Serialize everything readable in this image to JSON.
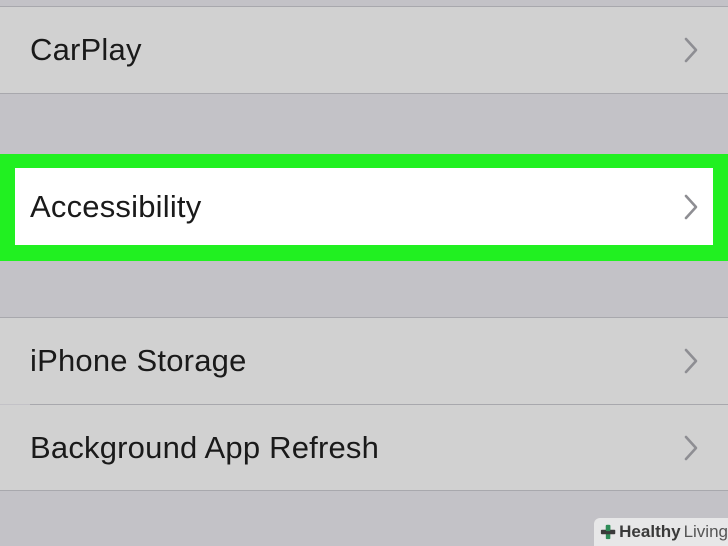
{
  "settings": {
    "rows": [
      {
        "label": "CarPlay"
      },
      {
        "label": "Accessibility"
      },
      {
        "label": "iPhone Storage"
      },
      {
        "label": "Background App Refresh"
      }
    ]
  },
  "highlight_color": "#21f021",
  "watermark": {
    "brand_bold": "Healthy",
    "brand_rest": "Living"
  }
}
